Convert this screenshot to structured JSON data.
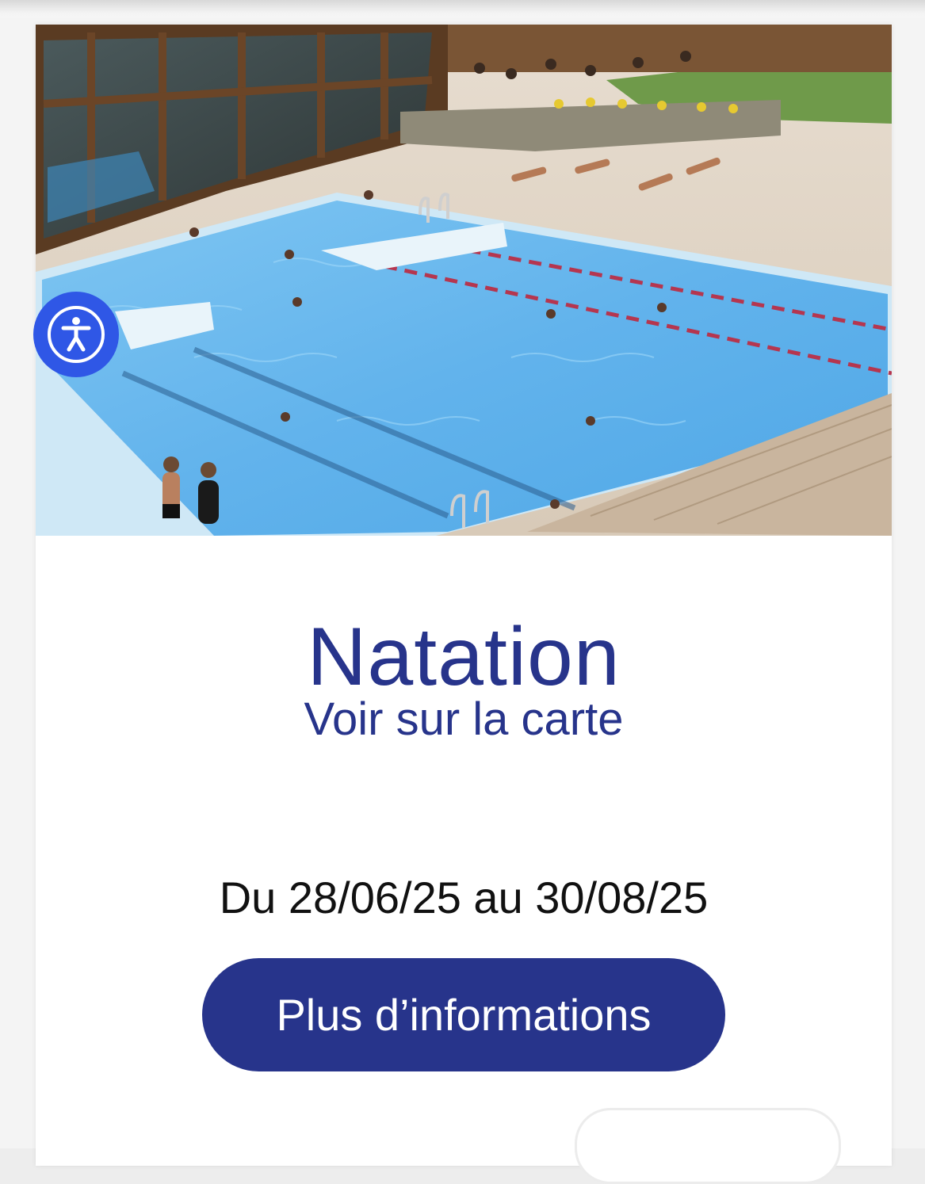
{
  "activity": {
    "title": "Natation",
    "map_link_label": "Voir sur la carte",
    "dates_label": "Du 28/06/25 au 30/08/25",
    "more_info_label": "Plus d’informations"
  },
  "accessibility_button": {
    "icon": "accessibility-person-icon"
  },
  "colors": {
    "brand_blue": "#27348b",
    "accessibility_blue": "#2f57e6"
  }
}
